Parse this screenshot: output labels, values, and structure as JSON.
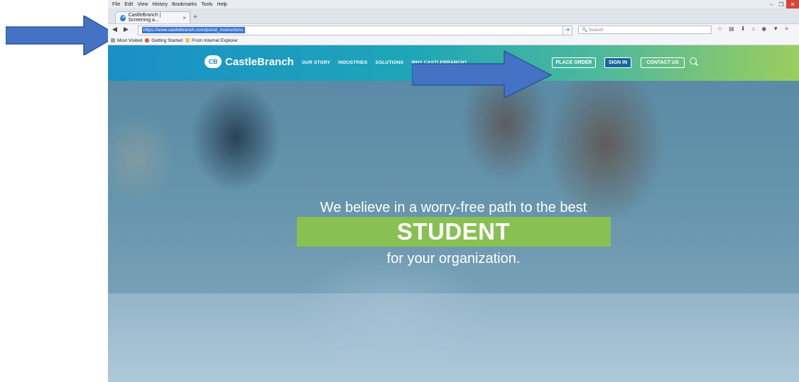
{
  "menu": [
    "File",
    "Edit",
    "View",
    "History",
    "Bookmarks",
    "Tools",
    "Help"
  ],
  "tab": {
    "title": "CastleBranch | Screening a...",
    "favicon_text": "CB"
  },
  "url": "https://www.castlebranch.com/portal_instructions",
  "search_placeholder": "Search",
  "bookmarks": [
    "Most Visited",
    "Getting Started",
    "From Internet Explorer"
  ],
  "site": {
    "logo_mark": "CB",
    "logo_text": "CastleBranch",
    "nav": [
      "OUR STORY",
      "INDUSTRIES",
      "SOLUTIONS",
      "WHY CASTLEBRANCH?"
    ],
    "place_order": "PLACE ORDER",
    "sign_in": "SIGN IN",
    "contact_us": "CONTACT US"
  },
  "hero": {
    "line1": "We believe in a worry-free path to the best",
    "line2": "STUDENT",
    "line3": "for your organization."
  },
  "colors": {
    "arrow": "#4472c4",
    "accent_green": "#8bc34a",
    "header_blue": "#1a8fc7"
  }
}
